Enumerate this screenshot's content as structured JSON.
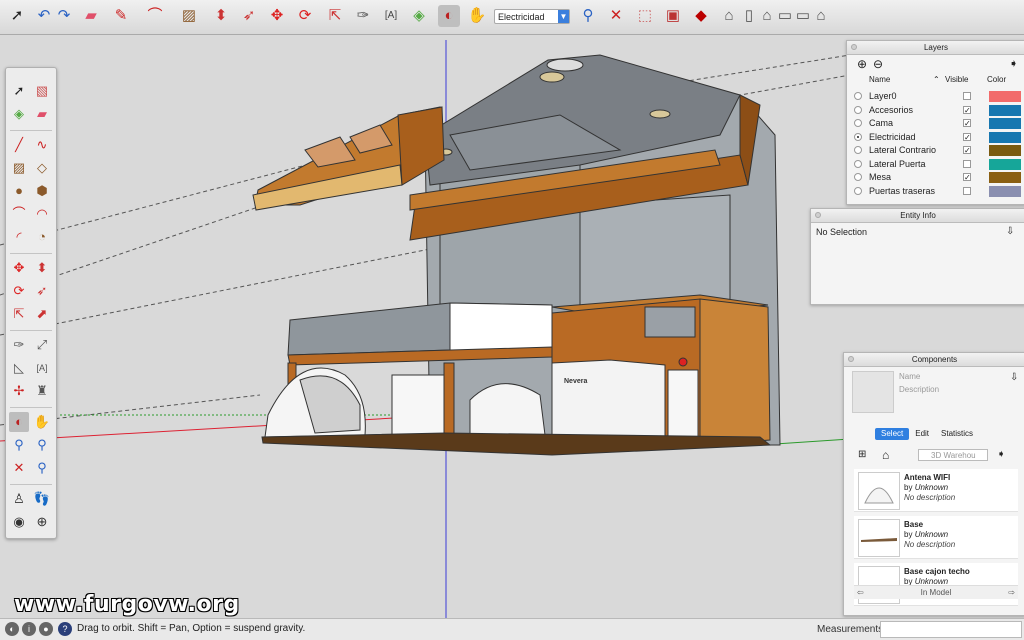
{
  "toolbar": {
    "layer_select": "Electricidad",
    "icons": [
      "select-icon",
      "undo-icon",
      "redo-icon",
      "eraser-icon",
      "pencil-icon",
      "arc-icon",
      "rectangle-icon",
      "push-pull-icon",
      "follow-me-icon",
      "move-icon",
      "rotate-icon",
      "scale-icon",
      "tape-measure-icon",
      "text-icon",
      "paint-bucket-icon",
      "orbit-icon",
      "pan-icon",
      "zoom-icon",
      "zoom-extents-icon",
      "warehouse-icon",
      "extension-icon",
      "ruby-icon",
      "iso-view-icon",
      "top-view-icon",
      "front-view-icon",
      "right-view-icon",
      "back-view-icon",
      "left-view-icon"
    ]
  },
  "layers": {
    "title": "Layers",
    "columns": {
      "name": "Name",
      "visible": "Visible",
      "color": "Color"
    },
    "rows": [
      {
        "name": "Layer0",
        "visible": false,
        "active": false,
        "color": "#f26b6b"
      },
      {
        "name": "Accesorios",
        "visible": true,
        "active": false,
        "color": "#1777b0"
      },
      {
        "name": "Cama",
        "visible": true,
        "active": false,
        "color": "#1777b0"
      },
      {
        "name": "Electricidad",
        "visible": true,
        "active": true,
        "color": "#1777b0"
      },
      {
        "name": "Lateral Contrario",
        "visible": true,
        "active": false,
        "color": "#7a5a10"
      },
      {
        "name": "Lateral Puerta",
        "visible": false,
        "active": false,
        "color": "#16a699"
      },
      {
        "name": "Mesa",
        "visible": true,
        "active": false,
        "color": "#8a5f12"
      },
      {
        "name": "Puertas traseras",
        "visible": false,
        "active": false,
        "color": "#8a8fb0"
      }
    ]
  },
  "entity_info": {
    "title": "Entity Info",
    "selection": "No Selection"
  },
  "components": {
    "title": "Components",
    "name_placeholder": "Name",
    "description_placeholder": "Description",
    "tabs": [
      "Select",
      "Edit",
      "Statistics"
    ],
    "active_tab": "Select",
    "search_placeholder": "3D Warehou",
    "footer": "In Model",
    "items": [
      {
        "name": "Antena WIFI",
        "by": "by",
        "author": "Unknown",
        "description": "No description"
      },
      {
        "name": "Base",
        "by": "by",
        "author": "Unknown",
        "description": "No description"
      },
      {
        "name": "Base cajon techo",
        "by": "by",
        "author": "Unknown",
        "description": ""
      }
    ]
  },
  "status": {
    "message": "Drag to orbit. Shift = Pan, Option = suspend gravity.",
    "measurements_label": "Measurements",
    "measurements_value": ""
  },
  "scene": {
    "fridge_label": "Nevera"
  },
  "watermark": "www.furgovw.org"
}
